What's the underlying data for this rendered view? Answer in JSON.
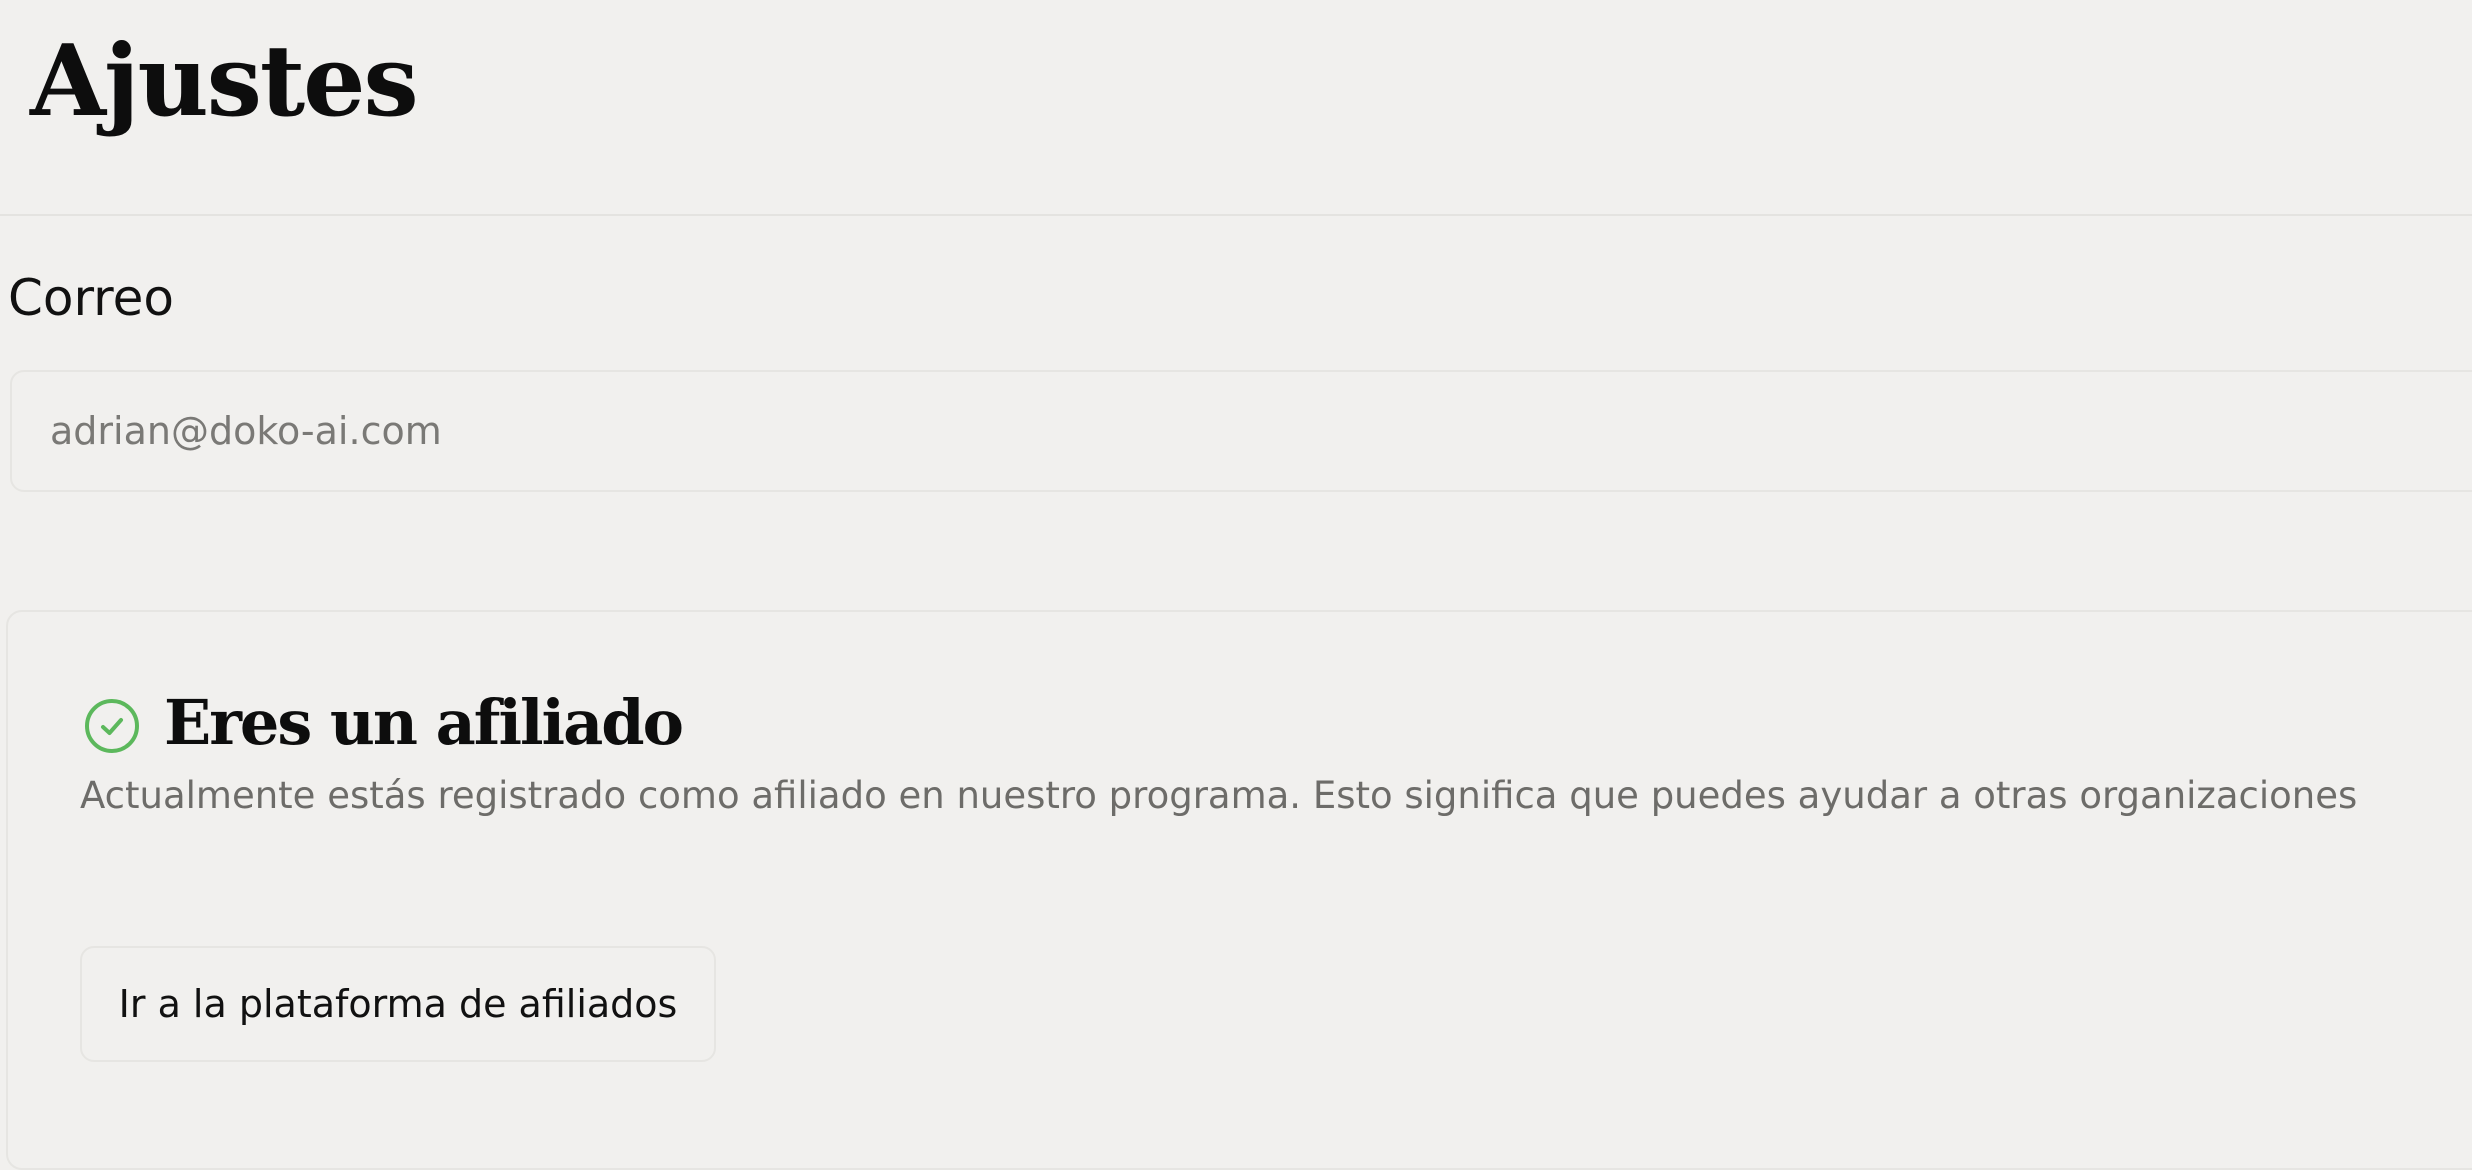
{
  "header": {
    "title": "Ajustes"
  },
  "email": {
    "label": "Correo",
    "value": "adrian@doko-ai.com"
  },
  "affiliate": {
    "icon": "check-circle-icon",
    "icon_color": "#5cb85c",
    "title": "Eres un afiliado",
    "description": "Actualmente estás registrado como afiliado en nuestro programa. Esto significa que puedes ayudar a otras organizaciones",
    "button_label": "Ir a la plataforma de afiliados"
  }
}
